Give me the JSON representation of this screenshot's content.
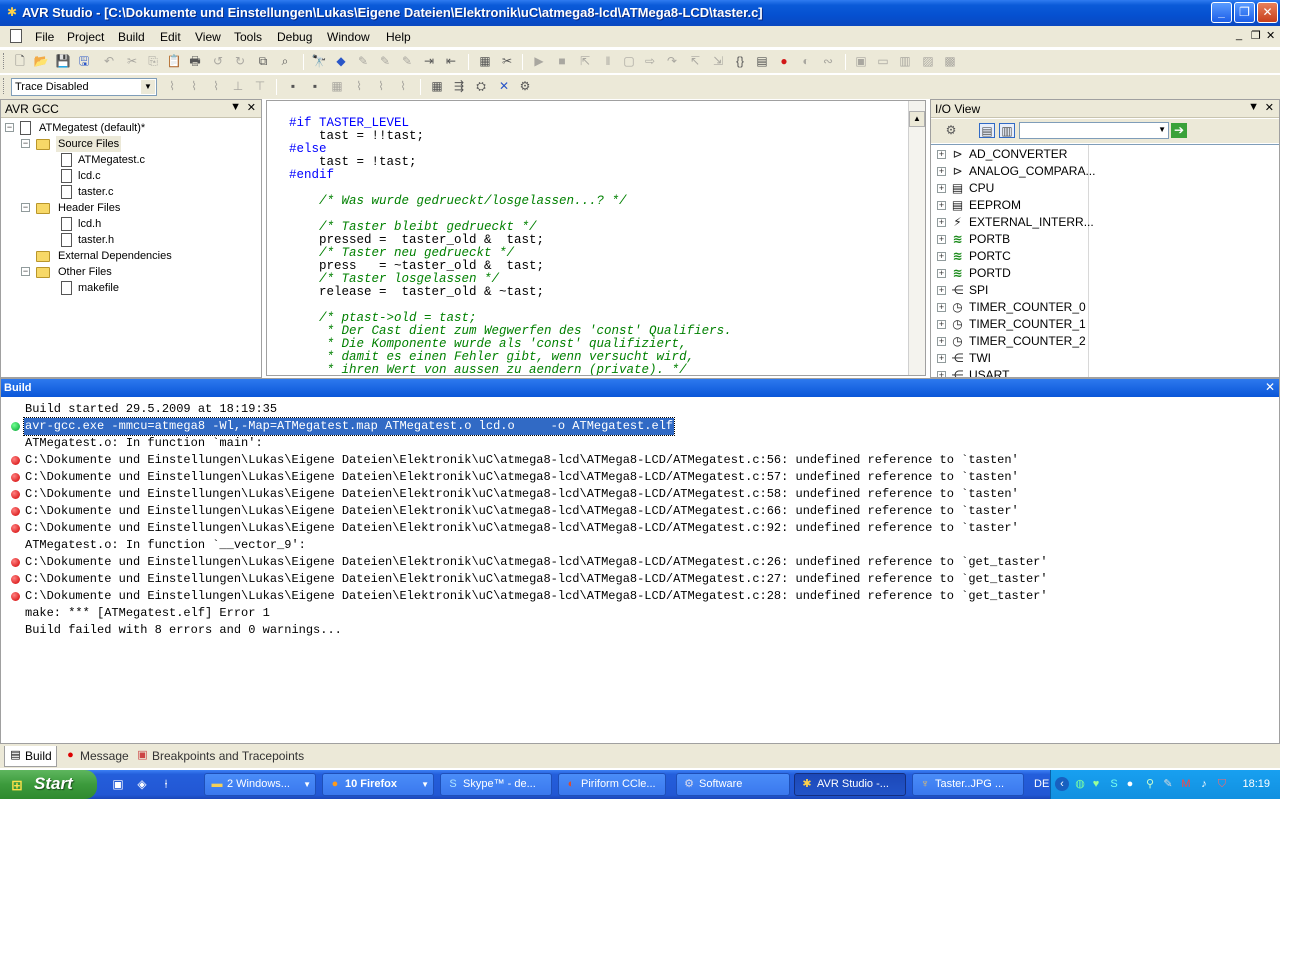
{
  "window": {
    "title": "AVR Studio - [C:\\Dokumente und Einstellungen\\Lukas\\Eigene Dateien\\Elektronik\\uC\\atmega8-lcd\\ATMega8-LCD\\taster.c]"
  },
  "menu": [
    "File",
    "Project",
    "Build",
    "Edit",
    "View",
    "Tools",
    "Debug",
    "Window",
    "Help"
  ],
  "toolbar": {
    "trace_value": "Trace Disabled"
  },
  "project_panel": {
    "title": "AVR GCC",
    "root": "ATMegatest (default)*",
    "source_folder": "Source Files",
    "sources": [
      "ATMegatest.c",
      "lcd.c",
      "taster.c"
    ],
    "header_folder": "Header Files",
    "headers": [
      "lcd.h",
      "taster.h"
    ],
    "external": "External Dependencies",
    "other_folder": "Other Files",
    "others": [
      "makefile"
    ]
  },
  "editor": {
    "lines": [
      "#if TASTER_LEVEL",
      "    tast = !!tast;",
      "#else",
      "    tast = !tast;",
      "#endif",
      "",
      "    /* Was wurde gedrueckt/losgelassen...? */",
      "",
      "    /* Taster bleibt gedrueckt */",
      "    pressed =  taster_old &  tast;",
      "    /* Taster neu gedrueckt */",
      "    press   = ~taster_old &  tast;",
      "    /* Taster losgelassen */",
      "    release =  taster_old & ~tast;",
      "",
      "    /* ptast->old = tast;",
      "     * Der Cast dient zum Wegwerfen des 'const' Qualifiers.",
      "     * Die Komponente wurde als 'const' qualifiziert,",
      "     * damit es einen Fehler gibt, wenn versucht wird,",
      "     * ihren Wert von aussen zu aendern (private). */"
    ]
  },
  "io_view": {
    "title": "I/O View",
    "items": [
      {
        "label": "AD_CONVERTER",
        "icon": "converter-icon"
      },
      {
        "label": "ANALOG_COMPARA...",
        "icon": "comparator-icon"
      },
      {
        "label": "CPU",
        "icon": "cpu-icon"
      },
      {
        "label": "EEPROM",
        "icon": "eeprom-icon"
      },
      {
        "label": "EXTERNAL_INTERR...",
        "icon": "interrupt-icon"
      },
      {
        "label": "PORTB",
        "icon": "port-icon"
      },
      {
        "label": "PORTC",
        "icon": "port-icon"
      },
      {
        "label": "PORTD",
        "icon": "port-icon"
      },
      {
        "label": "SPI",
        "icon": "spi-icon"
      },
      {
        "label": "TIMER_COUNTER_0",
        "icon": "timer-icon"
      },
      {
        "label": "TIMER_COUNTER_1",
        "icon": "timer-icon"
      },
      {
        "label": "TIMER_COUNTER_2",
        "icon": "timer-icon"
      },
      {
        "label": "TWI",
        "icon": "twi-icon"
      },
      {
        "label": "USART",
        "icon": "usart-icon"
      }
    ]
  },
  "build": {
    "title": "Build",
    "lines": [
      {
        "text": "Build started 29.5.2009 at 18:19:35",
        "marker": "none"
      },
      {
        "text": "avr-gcc.exe -mmcu=atmega8 -Wl,-Map=ATMegatest.map ATMegatest.o lcd.o     -o ATMegatest.elf",
        "marker": "green"
      },
      {
        "text": "ATMegatest.o: In function `main':",
        "marker": "none"
      },
      {
        "text": "C:\\Dokumente und Einstellungen\\Lukas\\Eigene Dateien\\Elektronik\\uC\\atmega8-lcd\\ATMega8-LCD/ATMegatest.c:56: undefined reference to `tasten'",
        "marker": "red"
      },
      {
        "text": "C:\\Dokumente und Einstellungen\\Lukas\\Eigene Dateien\\Elektronik\\uC\\atmega8-lcd\\ATMega8-LCD/ATMegatest.c:57: undefined reference to `tasten'",
        "marker": "red"
      },
      {
        "text": "C:\\Dokumente und Einstellungen\\Lukas\\Eigene Dateien\\Elektronik\\uC\\atmega8-lcd\\ATMega8-LCD/ATMegatest.c:58: undefined reference to `tasten'",
        "marker": "red"
      },
      {
        "text": "C:\\Dokumente und Einstellungen\\Lukas\\Eigene Dateien\\Elektronik\\uC\\atmega8-lcd\\ATMega8-LCD/ATMegatest.c:66: undefined reference to `taster'",
        "marker": "red"
      },
      {
        "text": "C:\\Dokumente und Einstellungen\\Lukas\\Eigene Dateien\\Elektronik\\uC\\atmega8-lcd\\ATMega8-LCD/ATMegatest.c:92: undefined reference to `taster'",
        "marker": "red"
      },
      {
        "text": "ATMegatest.o: In function `__vector_9':",
        "marker": "none"
      },
      {
        "text": "C:\\Dokumente und Einstellungen\\Lukas\\Eigene Dateien\\Elektronik\\uC\\atmega8-lcd\\ATMega8-LCD/ATMegatest.c:26: undefined reference to `get_taster'",
        "marker": "red"
      },
      {
        "text": "C:\\Dokumente und Einstellungen\\Lukas\\Eigene Dateien\\Elektronik\\uC\\atmega8-lcd\\ATMega8-LCD/ATMegatest.c:27: undefined reference to `get_taster'",
        "marker": "red"
      },
      {
        "text": "C:\\Dokumente und Einstellungen\\Lukas\\Eigene Dateien\\Elektronik\\uC\\atmega8-lcd\\ATMega8-LCD/ATMegatest.c:28: undefined reference to `get_taster'",
        "marker": "red"
      },
      {
        "text": "make: *** [ATMegatest.elf] Error 1",
        "marker": "none"
      },
      {
        "text": "Build failed with 8 errors and 0 warnings...",
        "marker": "none"
      }
    ]
  },
  "bottom_tabs": [
    "Build",
    "Message",
    "Breakpoints and Tracepoints"
  ],
  "taskbar": {
    "start": "Start",
    "tasks": [
      "2 Windows...",
      "10 Firefox",
      "Skype™ - de...",
      "Piriform CCle...",
      "Software",
      "AVR Studio -...",
      "Taster..JPG ..."
    ],
    "language": "DE",
    "clock": "18:19"
  }
}
